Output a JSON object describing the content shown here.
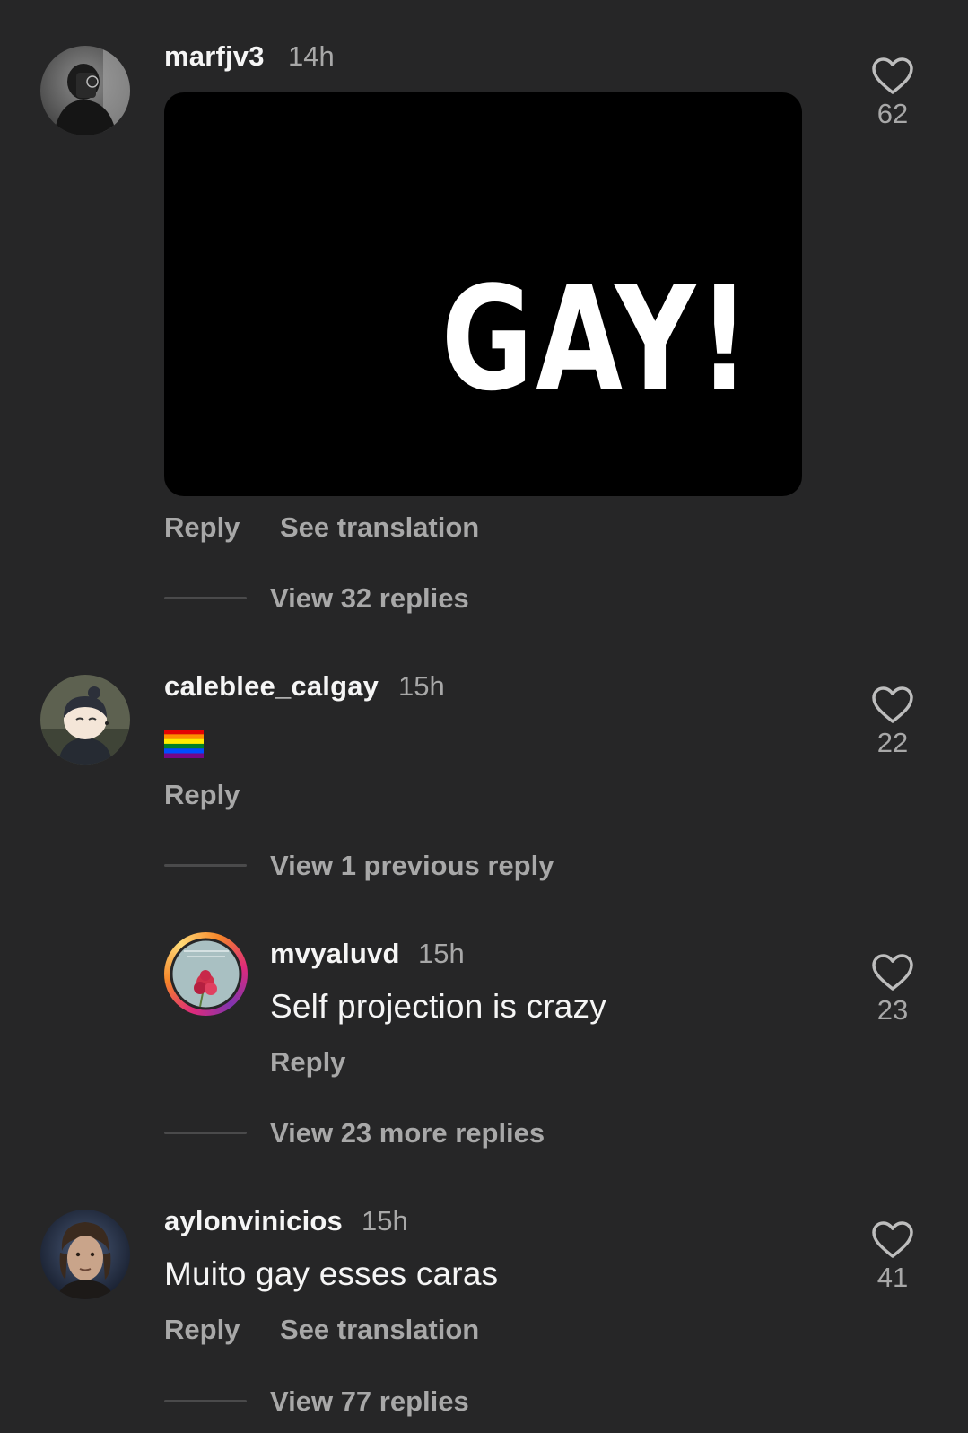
{
  "comments": [
    {
      "username": "marfjv3",
      "time": "14h",
      "gif_text": "GAY!",
      "actions": {
        "reply": "Reply",
        "translate": "See translation"
      },
      "view_replies": "View 32 replies",
      "likes": "62",
      "avatar": "avatar-person-dark"
    },
    {
      "username": "caleblee_calgay",
      "time": "15h",
      "emoji": "🏳️‍🌈",
      "emoji_name": "rainbow-flag-icon",
      "actions": {
        "reply": "Reply"
      },
      "view_replies": "View 1 previous reply",
      "likes": "22",
      "avatar": "avatar-cartoon"
    },
    {
      "username": "mvyaluvd",
      "time": "15h",
      "text": "Self projection is crazy",
      "actions": {
        "reply": "Reply"
      },
      "view_replies": "View 23 more replies",
      "likes": "23",
      "avatar": "avatar-flower-story-ring"
    },
    {
      "username": "aylonvinicios",
      "time": "15h",
      "text": "Muito gay esses caras",
      "actions": {
        "reply": "Reply",
        "translate": "See translation"
      },
      "view_replies": "View 77 replies",
      "likes": "41",
      "avatar": "avatar-portrait"
    }
  ],
  "colors": {
    "background": "#262627",
    "primary_text": "#f5f5f5",
    "secondary_text": "#a8a8a8",
    "story_ring_start": "#f58529",
    "story_ring_end": "#dd2a7b"
  }
}
